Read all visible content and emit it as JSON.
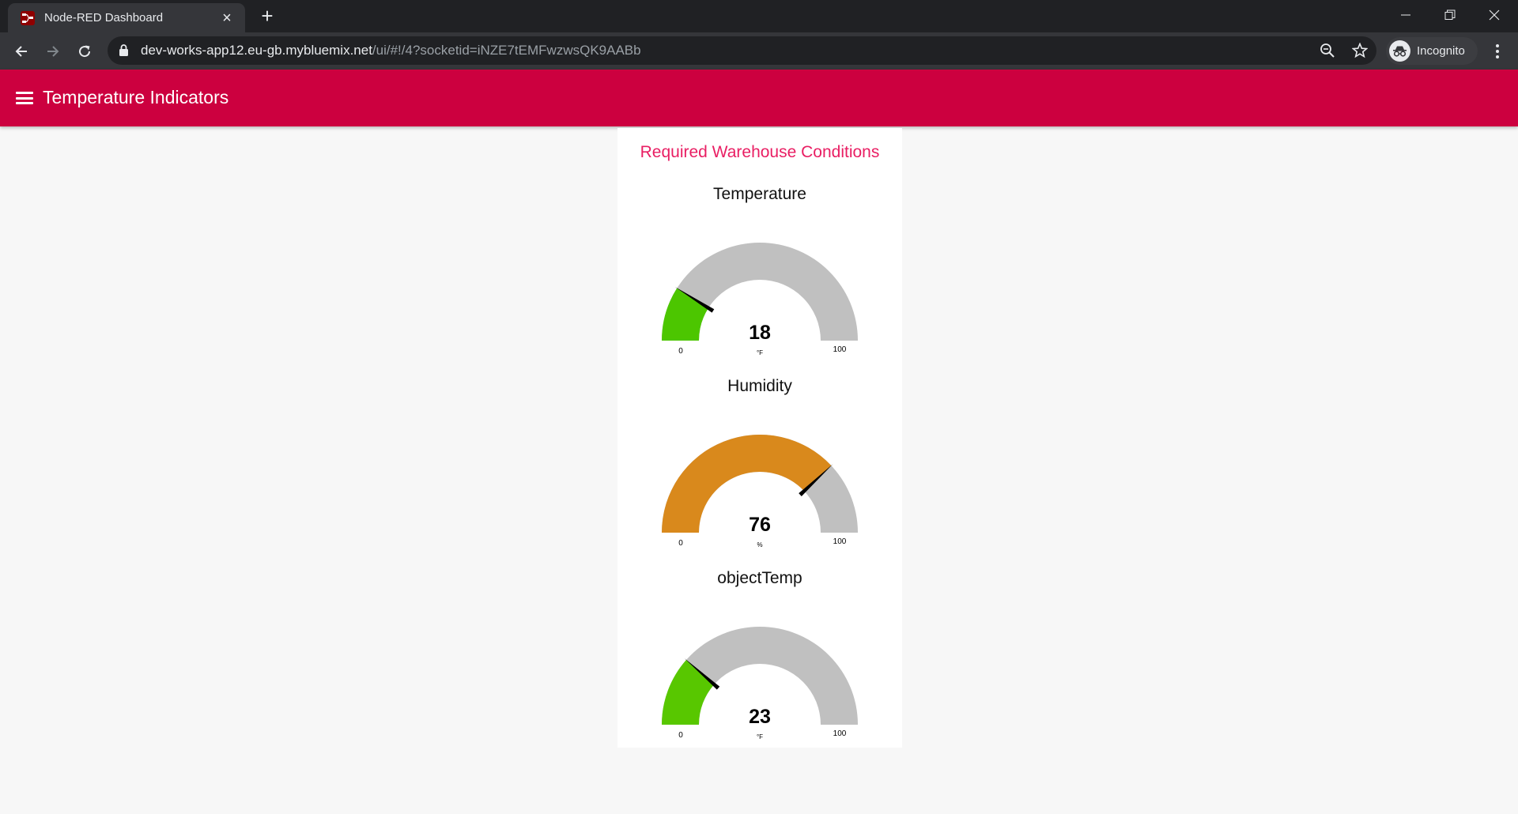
{
  "browser": {
    "tab_title": "Node-RED Dashboard",
    "url_host": "dev-works-app12.eu-gb.mybluemix.net",
    "url_path": "/ui/#!/4?socketid=iNZE7tEMFwzwsQK9AABb",
    "profile_label": "Incognito"
  },
  "dashboard": {
    "title": "Temperature Indicators",
    "group_title": "Required Warehouse Conditions",
    "colors": {
      "header": "#cc003f",
      "group_title": "#e91e63",
      "track": "#c0c0c0",
      "needle": "#000000"
    },
    "gauges": [
      {
        "title": "Temperature",
        "value": 18,
        "units": "°F",
        "min": 0,
        "max": 100,
        "min_label": "0",
        "max_label": "100",
        "color": "#4cc600"
      },
      {
        "title": "Humidity",
        "value": 76,
        "units": "%",
        "min": 0,
        "max": 100,
        "min_label": "0",
        "max_label": "100",
        "color": "#d9891c"
      },
      {
        "title": "objectTemp",
        "value": 23,
        "units": "°F",
        "min": 0,
        "max": 100,
        "min_label": "0",
        "max_label": "100",
        "color": "#58c700"
      }
    ]
  }
}
